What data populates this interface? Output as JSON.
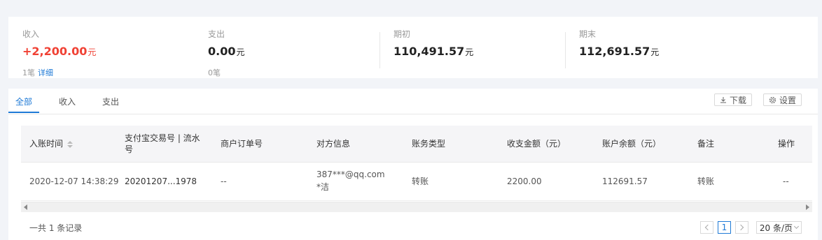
{
  "summary": {
    "income": {
      "label": "收入",
      "value": "+2,200.00",
      "unit": "元",
      "count": "1笔",
      "detail_link": "详细"
    },
    "expense": {
      "label": "支出",
      "value": "0.00",
      "unit": "元",
      "count": "0笔"
    },
    "opening": {
      "label": "期初",
      "value": "110,491.57",
      "unit": "元"
    },
    "closing": {
      "label": "期末",
      "value": "112,691.57",
      "unit": "元"
    }
  },
  "tabs": [
    {
      "label": "全部",
      "active": true
    },
    {
      "label": "收入",
      "active": false
    },
    {
      "label": "支出",
      "active": false
    }
  ],
  "toolbar": {
    "download_label": "下载",
    "settings_label": "设置"
  },
  "table": {
    "columns": [
      "入账时间",
      "支付宝交易号 | 流水号",
      "商户订单号",
      "对方信息",
      "账务类型",
      "收支金额（元）",
      "账户余额（元）",
      "备注",
      "操作"
    ],
    "rows": [
      {
        "time": "2020-12-07 14:38:29",
        "trade_no": "20201207...1978",
        "order_no": "--",
        "counterparty_line1": "387***@qq.com",
        "counterparty_line2": "*洁",
        "type": "转账",
        "amount": "2200.00",
        "balance": "112691.57",
        "remark": "转账",
        "action": "--"
      }
    ]
  },
  "footer": {
    "total": "一共 1 条记录",
    "current_page": "1",
    "page_size": "20 条/页"
  },
  "colors": {
    "accent": "#1f7ad6",
    "income": "#f04134",
    "background": "#f2f4f8"
  }
}
